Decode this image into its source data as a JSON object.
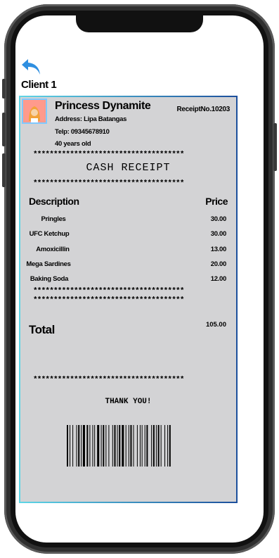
{
  "header": {
    "client_label": "Client 1"
  },
  "receipt": {
    "name": "Princess Dynamite",
    "receipt_no": "ReceiptNo.10203",
    "address": "Address: Lipa Batangas",
    "phone": "Telp: 09345678910",
    "age": "40 years old",
    "stars": "*************************************",
    "title": "CASH RECEIPT",
    "col_description": "Description",
    "col_price": "Price",
    "items": [
      {
        "desc": "Pringles",
        "price": "30.00"
      },
      {
        "desc": "UFC Ketchup",
        "price": "30.00"
      },
      {
        "desc": "Amoxicillin",
        "price": "13.00"
      },
      {
        "desc": "Mega Sardines",
        "price": "20.00"
      },
      {
        "desc": "Baking Soda",
        "price": "12.00"
      }
    ],
    "total_label": "Total",
    "total_value": "105.00",
    "thanks": "THANK YOU!"
  },
  "colors": {
    "receipt_bg": "#d3d3d5",
    "border_left": "#5ed6e6",
    "border_right": "#1c4f9c",
    "back_icon": "#2f8fe0",
    "avatar_bg": "#ff9a8c"
  }
}
